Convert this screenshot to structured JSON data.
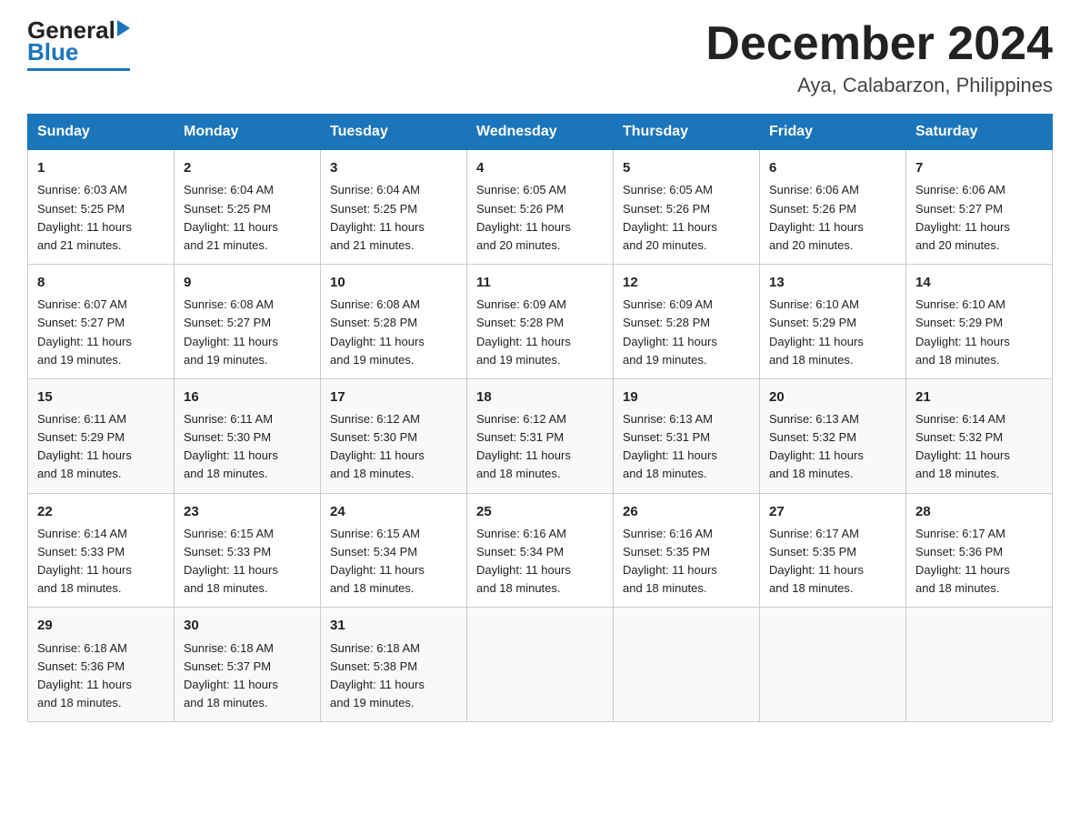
{
  "header": {
    "logo_general": "General",
    "logo_blue": "Blue",
    "month_title": "December 2024",
    "location": "Aya, Calabarzon, Philippines"
  },
  "days_of_week": [
    "Sunday",
    "Monday",
    "Tuesday",
    "Wednesday",
    "Thursday",
    "Friday",
    "Saturday"
  ],
  "weeks": [
    [
      {
        "day": "1",
        "sunrise": "6:03 AM",
        "sunset": "5:25 PM",
        "daylight": "11 hours and 21 minutes."
      },
      {
        "day": "2",
        "sunrise": "6:04 AM",
        "sunset": "5:25 PM",
        "daylight": "11 hours and 21 minutes."
      },
      {
        "day": "3",
        "sunrise": "6:04 AM",
        "sunset": "5:25 PM",
        "daylight": "11 hours and 21 minutes."
      },
      {
        "day": "4",
        "sunrise": "6:05 AM",
        "sunset": "5:26 PM",
        "daylight": "11 hours and 20 minutes."
      },
      {
        "day": "5",
        "sunrise": "6:05 AM",
        "sunset": "5:26 PM",
        "daylight": "11 hours and 20 minutes."
      },
      {
        "day": "6",
        "sunrise": "6:06 AM",
        "sunset": "5:26 PM",
        "daylight": "11 hours and 20 minutes."
      },
      {
        "day": "7",
        "sunrise": "6:06 AM",
        "sunset": "5:27 PM",
        "daylight": "11 hours and 20 minutes."
      }
    ],
    [
      {
        "day": "8",
        "sunrise": "6:07 AM",
        "sunset": "5:27 PM",
        "daylight": "11 hours and 19 minutes."
      },
      {
        "day": "9",
        "sunrise": "6:08 AM",
        "sunset": "5:27 PM",
        "daylight": "11 hours and 19 minutes."
      },
      {
        "day": "10",
        "sunrise": "6:08 AM",
        "sunset": "5:28 PM",
        "daylight": "11 hours and 19 minutes."
      },
      {
        "day": "11",
        "sunrise": "6:09 AM",
        "sunset": "5:28 PM",
        "daylight": "11 hours and 19 minutes."
      },
      {
        "day": "12",
        "sunrise": "6:09 AM",
        "sunset": "5:28 PM",
        "daylight": "11 hours and 19 minutes."
      },
      {
        "day": "13",
        "sunrise": "6:10 AM",
        "sunset": "5:29 PM",
        "daylight": "11 hours and 18 minutes."
      },
      {
        "day": "14",
        "sunrise": "6:10 AM",
        "sunset": "5:29 PM",
        "daylight": "11 hours and 18 minutes."
      }
    ],
    [
      {
        "day": "15",
        "sunrise": "6:11 AM",
        "sunset": "5:29 PM",
        "daylight": "11 hours and 18 minutes."
      },
      {
        "day": "16",
        "sunrise": "6:11 AM",
        "sunset": "5:30 PM",
        "daylight": "11 hours and 18 minutes."
      },
      {
        "day": "17",
        "sunrise": "6:12 AM",
        "sunset": "5:30 PM",
        "daylight": "11 hours and 18 minutes."
      },
      {
        "day": "18",
        "sunrise": "6:12 AM",
        "sunset": "5:31 PM",
        "daylight": "11 hours and 18 minutes."
      },
      {
        "day": "19",
        "sunrise": "6:13 AM",
        "sunset": "5:31 PM",
        "daylight": "11 hours and 18 minutes."
      },
      {
        "day": "20",
        "sunrise": "6:13 AM",
        "sunset": "5:32 PM",
        "daylight": "11 hours and 18 minutes."
      },
      {
        "day": "21",
        "sunrise": "6:14 AM",
        "sunset": "5:32 PM",
        "daylight": "11 hours and 18 minutes."
      }
    ],
    [
      {
        "day": "22",
        "sunrise": "6:14 AM",
        "sunset": "5:33 PM",
        "daylight": "11 hours and 18 minutes."
      },
      {
        "day": "23",
        "sunrise": "6:15 AM",
        "sunset": "5:33 PM",
        "daylight": "11 hours and 18 minutes."
      },
      {
        "day": "24",
        "sunrise": "6:15 AM",
        "sunset": "5:34 PM",
        "daylight": "11 hours and 18 minutes."
      },
      {
        "day": "25",
        "sunrise": "6:16 AM",
        "sunset": "5:34 PM",
        "daylight": "11 hours and 18 minutes."
      },
      {
        "day": "26",
        "sunrise": "6:16 AM",
        "sunset": "5:35 PM",
        "daylight": "11 hours and 18 minutes."
      },
      {
        "day": "27",
        "sunrise": "6:17 AM",
        "sunset": "5:35 PM",
        "daylight": "11 hours and 18 minutes."
      },
      {
        "day": "28",
        "sunrise": "6:17 AM",
        "sunset": "5:36 PM",
        "daylight": "11 hours and 18 minutes."
      }
    ],
    [
      {
        "day": "29",
        "sunrise": "6:18 AM",
        "sunset": "5:36 PM",
        "daylight": "11 hours and 18 minutes."
      },
      {
        "day": "30",
        "sunrise": "6:18 AM",
        "sunset": "5:37 PM",
        "daylight": "11 hours and 18 minutes."
      },
      {
        "day": "31",
        "sunrise": "6:18 AM",
        "sunset": "5:38 PM",
        "daylight": "11 hours and 19 minutes."
      },
      null,
      null,
      null,
      null
    ]
  ],
  "labels": {
    "sunrise": "Sunrise:",
    "sunset": "Sunset:",
    "daylight": "Daylight:"
  }
}
